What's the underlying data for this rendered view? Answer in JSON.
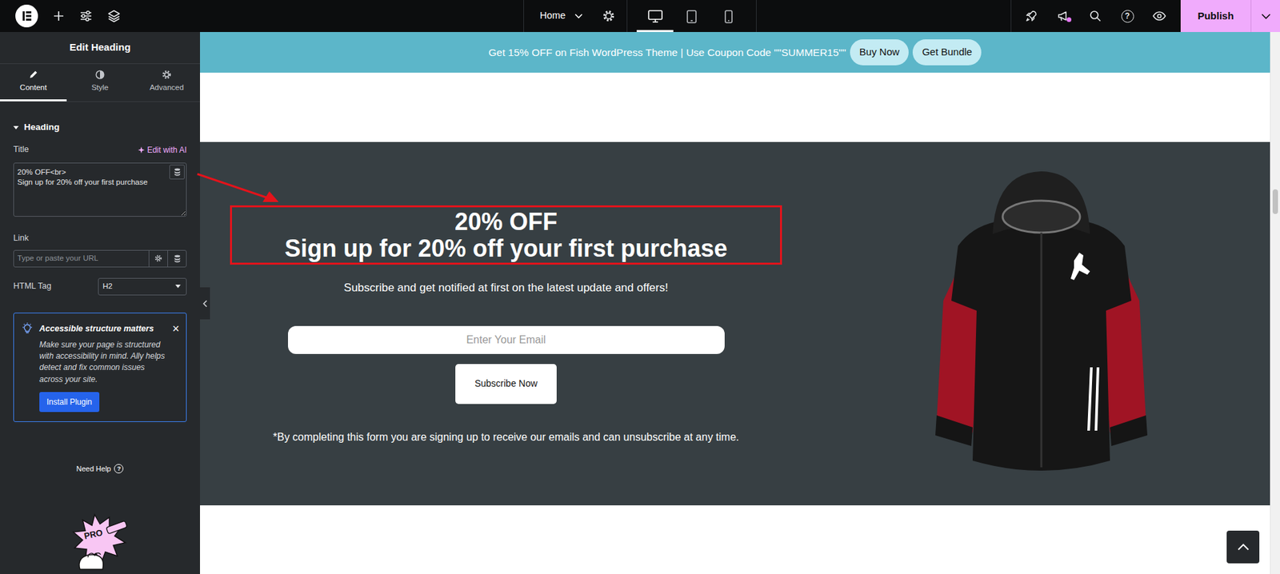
{
  "topbar": {
    "page": "Home",
    "devices": [
      {
        "kind": "desktop",
        "selected": true
      },
      {
        "kind": "tablet",
        "selected": false
      },
      {
        "kind": "mobile",
        "selected": false
      }
    ],
    "whats_new_unread": true,
    "help_icon": "?",
    "publish": "Publish"
  },
  "panel": {
    "title": "Edit Heading",
    "tabs": [
      {
        "label": "Content",
        "selected": true
      },
      {
        "label": "Style",
        "selected": false
      },
      {
        "label": "Advanced",
        "selected": false
      }
    ],
    "section": "Heading",
    "section_expanded": true,
    "title_label": "Title",
    "ai_link": "Edit with AI",
    "title_value": "20% OFF<br>\nSign up for 20% off your first purchase",
    "link_label": "Link",
    "link_placeholder": "Type or paste your URL",
    "tag_label": "HTML Tag",
    "tag_value": "H2",
    "notice": {
      "title": "Accessible structure matters",
      "text": "Make sure your page is structured with accessibility in mind. Ally helps detect and fix common issues across your site.",
      "button": "Install Plugin",
      "close": "×"
    },
    "help": "Need Help",
    "help_icon": "?",
    "promo_badge": "PRO"
  },
  "banner": {
    "text": "Get 15% OFF on Fish WordPress Theme | Use Coupon Code \"\"SUMMER15\"\"",
    "buttons": [
      "Buy Now",
      "Get Bundle"
    ]
  },
  "section": {
    "heading_lines": [
      "20% OFF",
      "Sign up for 20% off your first purchase"
    ],
    "heading_selected": true,
    "subtitle": "Subscribe and get notified at first on the latest update and offers!",
    "email_placeholder": "Enter Your Email",
    "button": "Subscribe Now",
    "disclaimer": "*By completing this form you are signing up to receive our emails and can unsubscribe at any time."
  }
}
